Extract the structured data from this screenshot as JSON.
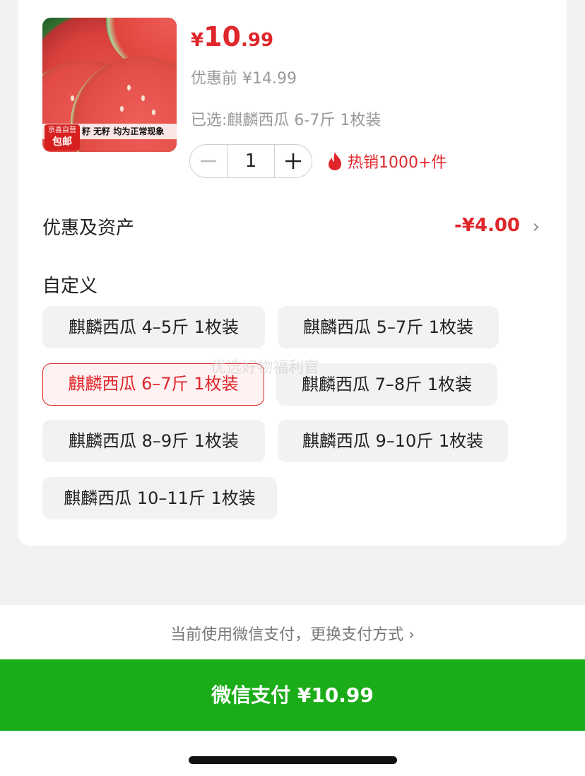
{
  "product": {
    "image_alt": "watermelon-image",
    "image_caption": "籽 无籽 均为正常现象",
    "image_brand_line1": "京喜自营",
    "image_brand_line2": "包邮",
    "price_symbol": "¥",
    "price_integer": "10",
    "price_decimal": ".99",
    "original_price": "优惠前 ¥14.99",
    "selected_text": "已选:麒麟西瓜 6-7斤 1枚装",
    "quantity": "1",
    "hot_sales": "热销1000+件"
  },
  "promo": {
    "label": "优惠及资产",
    "value": "-¥4.00",
    "chevron": "›"
  },
  "options": {
    "section_label": "自定义",
    "items": [
      {
        "label": "麒麟西瓜 4–5斤 1枚装",
        "selected": false
      },
      {
        "label": "麒麟西瓜 5–7斤 1枚装",
        "selected": false
      },
      {
        "label": "麒麟西瓜 6–7斤 1枚装",
        "selected": true
      },
      {
        "label": "麒麟西瓜 7–8斤 1枚装",
        "selected": false
      },
      {
        "label": "麒麟西瓜 8–9斤 1枚装",
        "selected": false
      },
      {
        "label": "麒麟西瓜 9–10斤 1枚装",
        "selected": false
      },
      {
        "label": "麒麟西瓜 10–11斤 1枚装",
        "selected": false
      }
    ]
  },
  "watermark": "优选好物福利官",
  "payment": {
    "hint": "当前使用微信支付，更换支付方式 ›",
    "button_label": "微信支付 ¥10.99"
  },
  "colors": {
    "accent_red": "#e0262b",
    "wechat_green": "#1aad19"
  }
}
